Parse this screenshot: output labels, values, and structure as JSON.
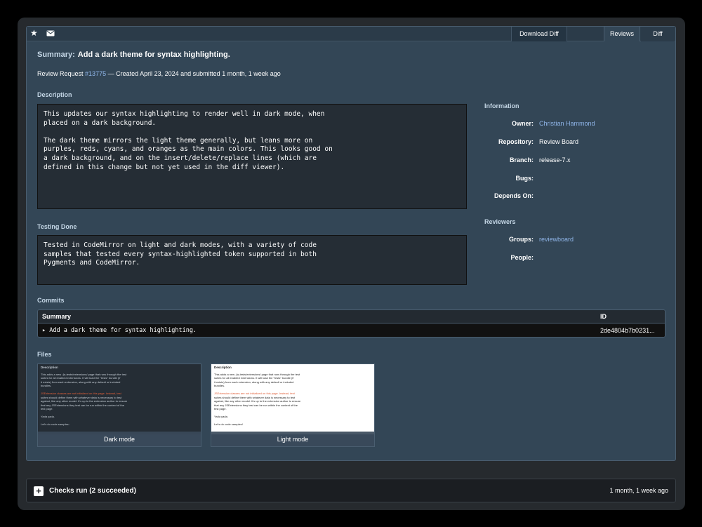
{
  "topbar": {
    "download_diff": "Download Diff",
    "tabs": [
      {
        "label": "Reviews"
      },
      {
        "label": "Diff"
      }
    ]
  },
  "summary": {
    "label": "Summary:",
    "text": "Add a dark theme for syntax highlighting."
  },
  "meta": {
    "prefix": "Review Request ",
    "id": "#13775",
    "suffix": " — Created April 23, 2024 and submitted 1 month, 1 week ago"
  },
  "description": {
    "heading": "Description",
    "body": "This updates our syntax highlighting to render well in dark mode, when\nplaced on a dark background.\n\nThe dark theme mirrors the light theme generally, but leans more on\npurples, reds, cyans, and oranges as the main colors. This looks good on\na dark background, and on the insert/delete/replace lines (which are\ndefined in this change but not yet used in the diff viewer)."
  },
  "testing": {
    "heading": "Testing Done",
    "body": "Tested in CodeMirror on light and dark modes, with a variety of code\nsamples that tested every syntax-highlighted token supported in both\nPygments and CodeMirror."
  },
  "information": {
    "heading": "Information",
    "owner_key": "Owner:",
    "owner_val": "Christian Hammond",
    "repo_key": "Repository:",
    "repo_val": "Review Board",
    "branch_key": "Branch:",
    "branch_val": "release-7.x",
    "bugs_key": "Bugs:",
    "depends_key": "Depends On:"
  },
  "reviewers": {
    "heading": "Reviewers",
    "groups_key": "Groups:",
    "groups_val": "reviewboard",
    "people_key": "People:"
  },
  "commits": {
    "heading": "Commits",
    "col_summary": "Summary",
    "col_id": "ID",
    "rows": [
      {
        "summary": "▸ Add a dark theme for syntax highlighting.",
        "id": "2de4804b7b0231..."
      }
    ]
  },
  "files": {
    "heading": "Files",
    "items": [
      {
        "label": "Dark mode",
        "thumb_title": "Description",
        "thumb_lines": [
          "This adds a new ./js-tests/extensions/ page that runs through the test",
          "suites for all enabled extensions. It will load the \"tests\" bundle (if",
          "it exists) from each extension, along with any default or included",
          "bundles.",
          "",
          "JSExtension classes are not initialized on this page. Instead, test",
          "suites should define them with whatever data is necessary to test",
          "against, like any other model. It's up to the extension author to ensure",
          "that any JSExtensions they test can be run within the context of the",
          "test page.",
          "",
          "Yada yada.",
          "",
          "Let's do code samples:"
        ]
      },
      {
        "label": "Light mode",
        "thumb_title": "Description",
        "thumb_lines": [
          "This adds a new ./js-tests/extensions/ page that runs through the test",
          "suites for all enabled extensions. It will load the \"tests\" bundle (if",
          "it exists) from each extension, along with any default or included",
          "bundles.",
          "",
          "JSExtension classes are not initialized on this page. Instead, test",
          "suites should define them with whatever data is necessary to test",
          "against, like any other model. It's up to the extension author to ensure",
          "that any JSExtensions they test can be run within the context of the",
          "test page.",
          "",
          "Yada yada.",
          "",
          "Let's do code samples!"
        ]
      }
    ]
  },
  "checks": {
    "title": "Checks run (2 succeeded)",
    "time": "1 month, 1 week ago"
  },
  "icons": {
    "star": "star-icon",
    "mail": "mail-icon",
    "plus": "plus-icon"
  }
}
